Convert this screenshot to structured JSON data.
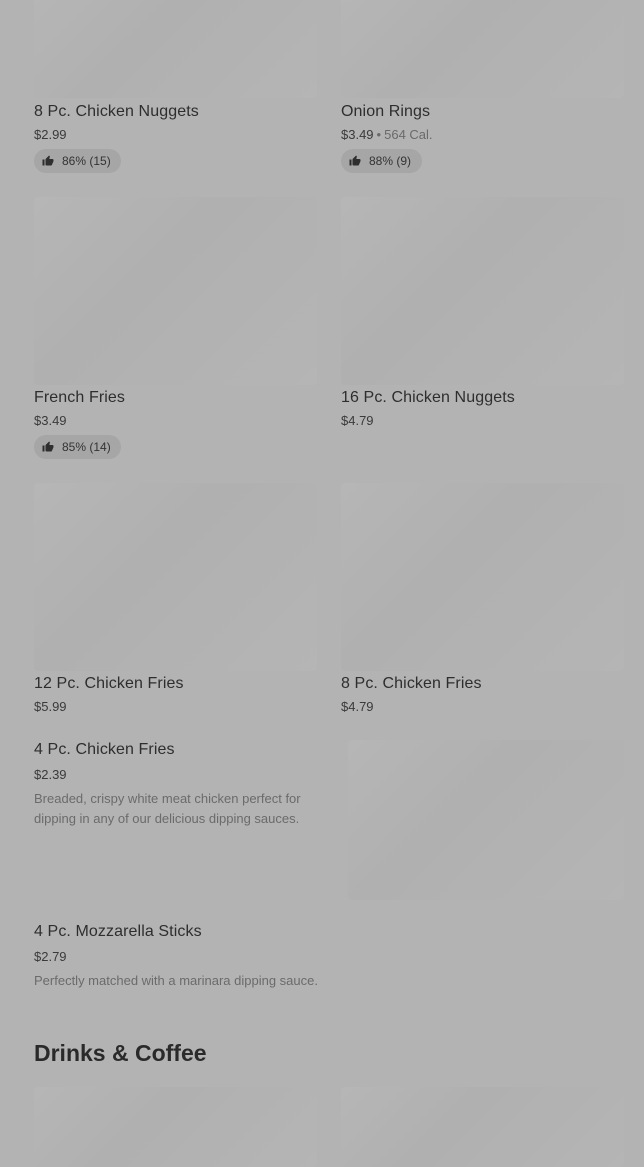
{
  "items": [
    {
      "name": "8 Pc. Chicken Nuggets",
      "price": "$2.99",
      "rating": "86% (15)"
    },
    {
      "name": "Onion Rings",
      "price": "$3.49",
      "calories": "564 Cal.",
      "rating": "88% (9)"
    },
    {
      "name": "French Fries",
      "price": "$3.49",
      "rating": "85% (14)"
    },
    {
      "name": "16 Pc. Chicken Nuggets",
      "price": "$4.79"
    },
    {
      "name": "12 Pc. Chicken Fries",
      "price": "$5.99"
    },
    {
      "name": "8 Pc. Chicken Fries",
      "price": "$4.79"
    },
    {
      "name": "4 Pc. Chicken Fries",
      "price": "$2.39",
      "description": "Breaded, crispy white meat chicken perfect for dipping in any of our delicious dipping sauces."
    },
    {
      "name": "4 Pc. Mozzarella Sticks",
      "price": "$2.79",
      "description": "Perfectly matched with a marinara dipping sauce."
    }
  ],
  "sections": {
    "drinks_title": "Drinks & Coffee"
  },
  "separator": "•",
  "icons": {
    "rating": "thumbs-up-icon"
  }
}
